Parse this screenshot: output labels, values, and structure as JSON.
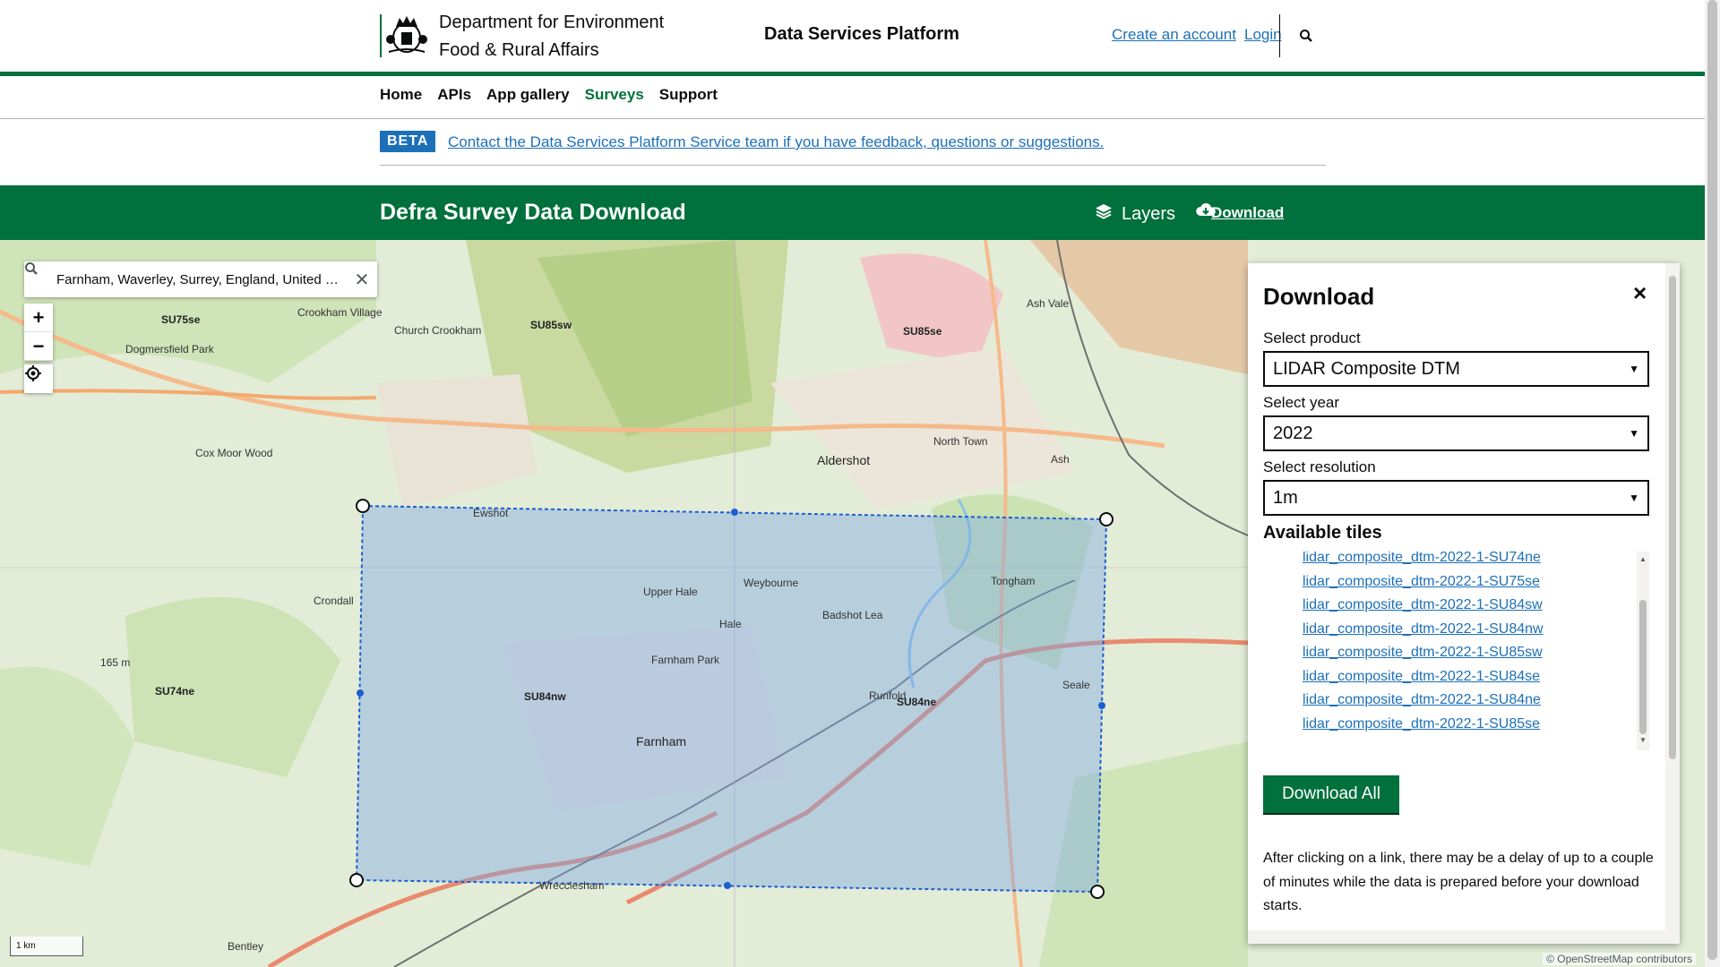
{
  "header": {
    "department_line1": "Department for Environment",
    "department_line2": "Food & Rural Affairs",
    "platform": "Data Services Platform",
    "create_account": "Create an account",
    "login": "Login",
    "search_icon": "search-icon"
  },
  "nav": [
    "Home",
    "APIs",
    "App gallery",
    "Surveys",
    "Support"
  ],
  "nav_active": "Surveys",
  "beta": {
    "tag": "BETA",
    "text": "Contact the Data Services Platform Service team if you have feedback, questions or suggestions."
  },
  "banner": {
    "title": "Defra Survey Data Download",
    "layers": "Layers",
    "download": "Download"
  },
  "map": {
    "search_value": "Farnham, Waverley, Surrey, England, United Kingdom",
    "zoom_in": "+",
    "zoom_out": "−",
    "scale": "1 km",
    "attribution": "© OpenStreetMap contributors",
    "tile_labels": [
      "SU75se",
      "SU85sw",
      "SU85se",
      "SU74ne",
      "SU84nw",
      "SU84ne"
    ],
    "places": [
      "Crookham Village",
      "Church Crookham",
      "Aldershot",
      "North Town",
      "Ash",
      "Ash Vale",
      "Ewshot",
      "Upper Hale",
      "Hale",
      "Weybourne",
      "Badshot Lea",
      "Tongham",
      "Farnham",
      "Runfold",
      "Seale",
      "Crondall",
      "Wrecclesham",
      "Bentley",
      "Farnham Park",
      "Dogmersfield Park",
      "Cox Moor Wood",
      "165 m"
    ]
  },
  "download_panel": {
    "title": "Download",
    "close_label": "×",
    "product_label": "Select product",
    "product_value": "LIDAR Composite DTM",
    "year_label": "Select year",
    "year_value": "2022",
    "resolution_label": "Select resolution",
    "resolution_value": "1m",
    "tiles_heading": "Available tiles",
    "tiles": [
      "lidar_composite_dtm-2022-1-SU74ne",
      "lidar_composite_dtm-2022-1-SU75se",
      "lidar_composite_dtm-2022-1-SU84sw",
      "lidar_composite_dtm-2022-1-SU84nw",
      "lidar_composite_dtm-2022-1-SU85sw",
      "lidar_composite_dtm-2022-1-SU84se",
      "lidar_composite_dtm-2022-1-SU84ne",
      "lidar_composite_dtm-2022-1-SU85se"
    ],
    "download_all": "Download All",
    "note": "After clicking on a link, there may be a delay of up to a couple of minutes while the data is prepared before your download starts."
  },
  "colors": {
    "brand_green": "#00703c",
    "link_blue": "#1d70b8",
    "selection_fill": "#7aa6e8",
    "selection_stroke": "#1d5fd1"
  }
}
